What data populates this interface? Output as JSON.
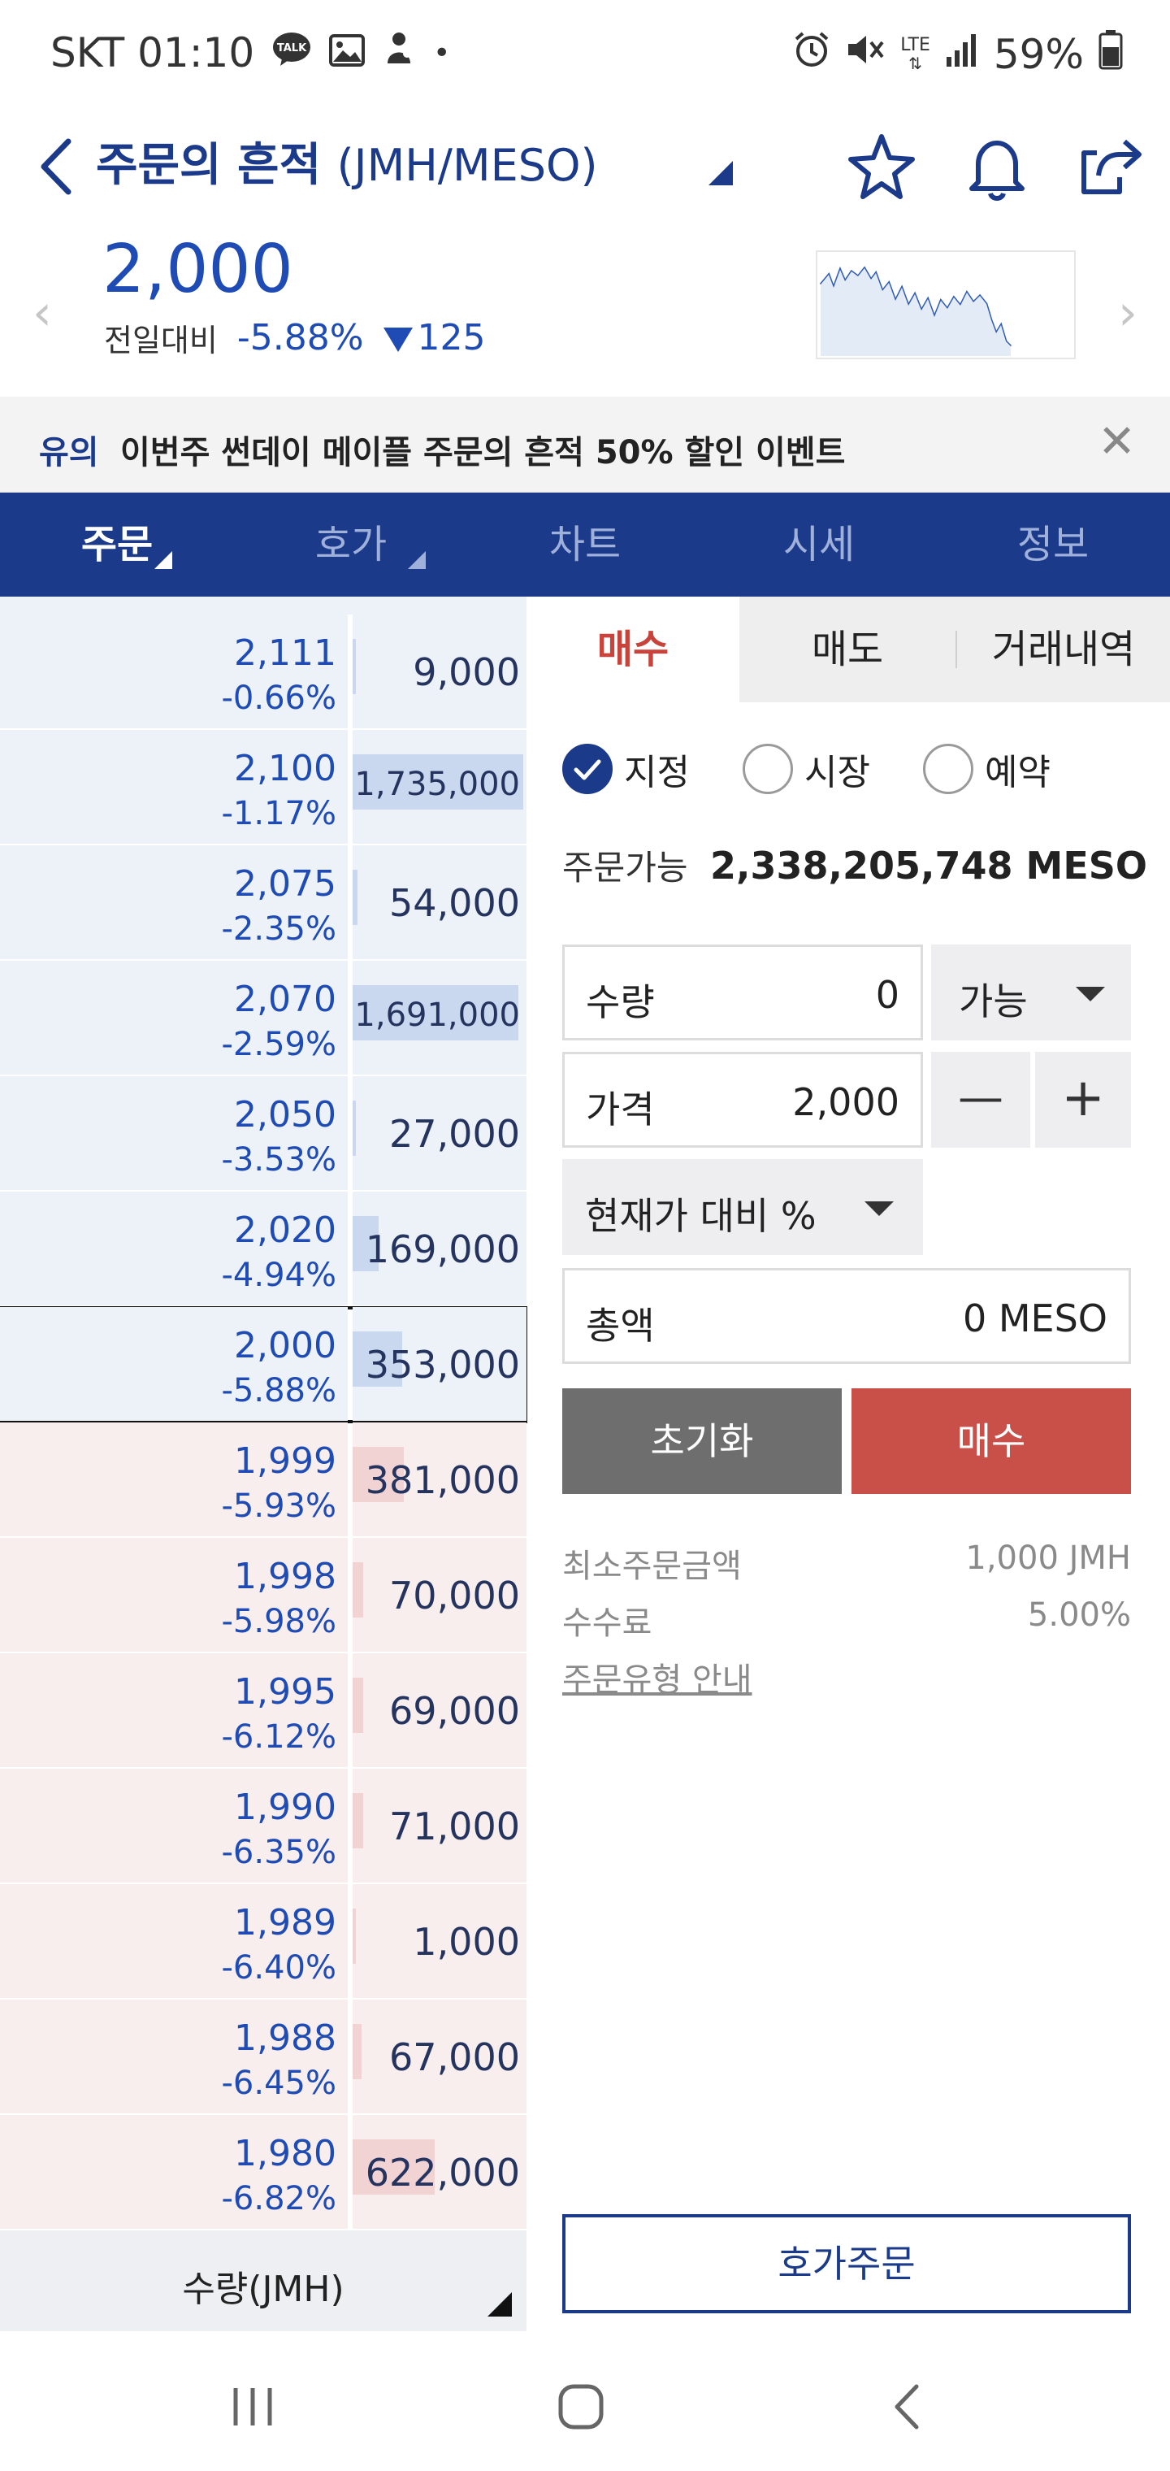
{
  "status_bar": {
    "carrier_time": "SKT 01:10",
    "talk_badge": "TALK",
    "dot": "•",
    "lte": "LTE",
    "battery": "59%"
  },
  "header": {
    "title": "주문의 흔적",
    "pair": "(JMH/MESO)",
    "icons": [
      "back-icon",
      "star-icon",
      "bell-icon",
      "share-icon"
    ]
  },
  "summary": {
    "price": "2,000",
    "compare_label": "전일대비",
    "change_pct": "-5.88%",
    "change_amt": "125",
    "nav_prev": "‹",
    "nav_next": "›"
  },
  "notice": {
    "tag": "유의",
    "text": "이번주 썬데이 메이플 주문의 흔적 50% 할인 이벤트",
    "close": "✕"
  },
  "main_tabs": [
    {
      "label": "주문",
      "active": true,
      "corner": true
    },
    {
      "label": "호가",
      "active": false,
      "corner": true
    },
    {
      "label": "차트",
      "active": false,
      "corner": false
    },
    {
      "label": "시세",
      "active": false,
      "corner": false
    },
    {
      "label": "정보",
      "active": false,
      "corner": false
    }
  ],
  "order_book": {
    "rows": [
      {
        "side": "ask",
        "price": "2,111",
        "pct": "-0.66%",
        "volume": "9,000",
        "depth": 0.01
      },
      {
        "side": "ask",
        "price": "2,100",
        "pct": "-1.17%",
        "volume": "1,735,000",
        "depth": 1.0
      },
      {
        "side": "ask",
        "price": "2,075",
        "pct": "-2.35%",
        "volume": "54,000",
        "depth": 0.03
      },
      {
        "side": "ask",
        "price": "2,070",
        "pct": "-2.59%",
        "volume": "1,691,000",
        "depth": 0.97
      },
      {
        "side": "ask",
        "price": "2,050",
        "pct": "-3.53%",
        "volume": "27,000",
        "depth": 0.02
      },
      {
        "side": "ask",
        "price": "2,020",
        "pct": "-4.94%",
        "volume": "169,000",
        "depth": 0.15
      },
      {
        "side": "ask",
        "price": "2,000",
        "pct": "-5.88%",
        "volume": "353,000",
        "depth": 0.29,
        "current": true
      },
      {
        "side": "bid",
        "price": "1,999",
        "pct": "-5.93%",
        "volume": "381,000",
        "depth": 0.3
      },
      {
        "side": "bid",
        "price": "1,998",
        "pct": "-5.98%",
        "volume": "70,000",
        "depth": 0.06
      },
      {
        "side": "bid",
        "price": "1,995",
        "pct": "-6.12%",
        "volume": "69,000",
        "depth": 0.06
      },
      {
        "side": "bid",
        "price": "1,990",
        "pct": "-6.35%",
        "volume": "71,000",
        "depth": 0.06
      },
      {
        "side": "bid",
        "price": "1,989",
        "pct": "-6.40%",
        "volume": "1,000",
        "depth": 0.0
      },
      {
        "side": "bid",
        "price": "1,988",
        "pct": "-6.45%",
        "volume": "67,000",
        "depth": 0.05
      },
      {
        "side": "bid",
        "price": "1,980",
        "pct": "-6.82%",
        "volume": "622,000",
        "depth": 0.48
      }
    ],
    "footer_label": "수량(JMH)"
  },
  "order_panel": {
    "tabs": [
      {
        "label": "매수",
        "active": true
      },
      {
        "label": "매도",
        "active": false
      },
      {
        "label": "거래내역",
        "active": false
      }
    ],
    "order_types": [
      {
        "label": "지정",
        "selected": true
      },
      {
        "label": "시장",
        "selected": false
      },
      {
        "label": "예약",
        "selected": false
      }
    ],
    "available_label": "주문가능",
    "available_value": "2,338,205,748 MESO",
    "quantity_label": "수량",
    "quantity_value": "0",
    "possible_label": "가능",
    "price_label": "가격",
    "price_value": "2,000",
    "minus": "—",
    "plus": "+",
    "pct_selector": "현재가 대비 %",
    "total_label": "총액",
    "total_value": "0 MESO",
    "reset_label": "초기화",
    "buy_label": "매수",
    "min_order_label": "최소주문금액",
    "min_order_value": "1,000 JMH",
    "fee_label": "수수료",
    "fee_value": "5.00%",
    "order_type_guide": "주문유형 안내",
    "hoga_order_label": "호가주문"
  },
  "colors": {
    "brand_navy": "#1b3a8a",
    "price_blue": "#1e4bb4",
    "buy_red": "#c95048",
    "reset_gray": "#6e6e6f"
  }
}
